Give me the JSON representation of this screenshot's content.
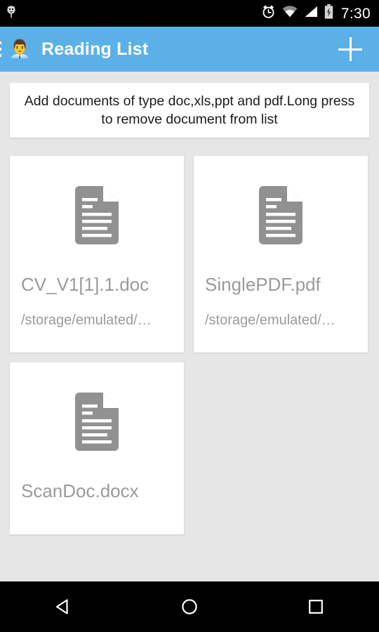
{
  "status_bar": {
    "notification_icon": "android-notification-icon",
    "alarm_icon": "alarm-clock-icon",
    "wifi_icon": "wifi-icon",
    "signal_icon": "cellular-signal-icon",
    "battery_icon": "battery-charging-icon",
    "time": "7:30",
    "background": "#000000"
  },
  "app_bar": {
    "menu_icon": "hamburger-menu-icon",
    "avatar_icon": "person-in-suit-avatar",
    "avatar_glyph": "👨‍💼",
    "title": "Reading List",
    "add_icon": "plus-icon",
    "background": "#5BB0E8",
    "text_color": "#FFFFFF"
  },
  "banner": {
    "text": "Add documents of type doc,xls,ppt and pdf.Long press to remove document from list",
    "background": "#FFFFFF",
    "text_color": "#1B1B1B"
  },
  "documents": [
    {
      "icon": "document-file-icon",
      "title": "CV_V1[1].1.doc",
      "path": "/storage/emulated/…",
      "has_path": true
    },
    {
      "icon": "document-file-icon",
      "title": "SinglePDF.pdf",
      "path": "/storage/emulated/…",
      "has_path": true
    },
    {
      "icon": "document-file-icon",
      "title": "ScanDoc.docx",
      "path": "",
      "has_path": false
    }
  ],
  "theme": {
    "page_background": "#E6E6E6",
    "card_background": "#FFFFFF",
    "muted_text": "#9B9B9B",
    "doc_icon_color": "#919191",
    "accent": "#5BB0E8"
  },
  "nav_bar": {
    "back_icon": "back-triangle-icon",
    "home_icon": "home-circle-icon",
    "recents_icon": "recents-square-icon",
    "background": "#000000"
  }
}
